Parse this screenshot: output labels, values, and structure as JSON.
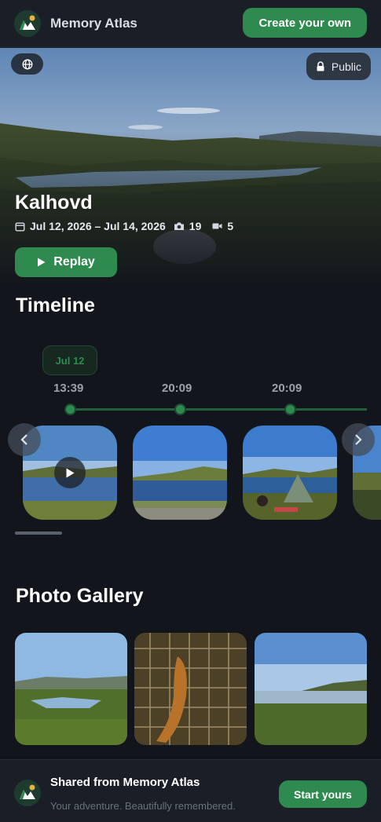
{
  "header": {
    "brand": "Memory Atlas",
    "create_label": "Create your own",
    "logo_icon": "memory-atlas-logo"
  },
  "hero": {
    "title": "Kalhovd",
    "date_range": "Jul 12, 2026 – Jul 14, 2026",
    "photo_count": "19",
    "video_count": "5",
    "visibility": "Public",
    "replay_label": "Replay",
    "icons": [
      "globe-icon",
      "lock-icon",
      "calendar-icon",
      "camera-icon",
      "video-icon",
      "play-icon"
    ]
  },
  "timeline": {
    "title": "Timeline",
    "date_chip": "Jul 12",
    "times": [
      "13:39",
      "20:09",
      "20:09"
    ],
    "items": [
      {
        "kind": "video",
        "scene": "lake-with-play"
      },
      {
        "kind": "photo",
        "scene": "lake-blue-sky"
      },
      {
        "kind": "photo",
        "scene": "tent-camp"
      }
    ]
  },
  "gallery": {
    "title": "Photo Gallery",
    "tiles": [
      "lake-meadow",
      "fish-in-net",
      "lake-shore-evening"
    ]
  },
  "footer": {
    "title": "Shared from Memory Atlas",
    "subtitle": "Your adventure. Beautifully remembered.",
    "cta": "Start yours"
  },
  "colors": {
    "accent": "#2f8a4f",
    "background": "#12151c",
    "panel": "#1a1f27"
  }
}
